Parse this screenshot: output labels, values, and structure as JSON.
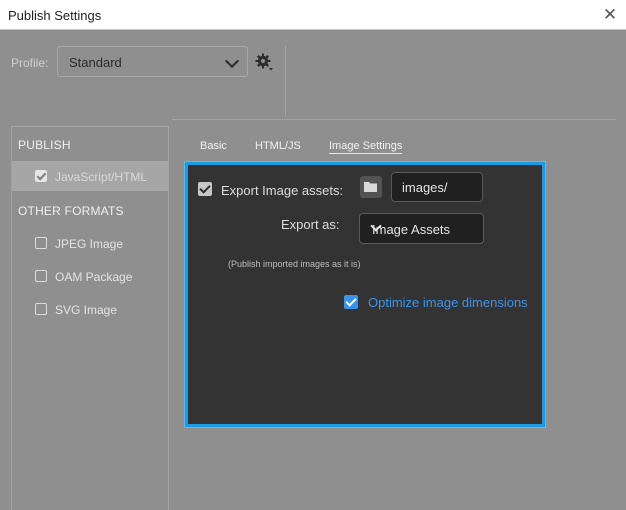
{
  "window": {
    "title": "Publish Settings",
    "close_glyph": "✕"
  },
  "profile": {
    "label": "Profile:",
    "value": "Standard"
  },
  "sidebar": {
    "publish_heading": "PUBLISH",
    "publish_items": [
      {
        "label": "JavaScript/HTML",
        "checked": true,
        "selected": true
      }
    ],
    "other_heading": "OTHER FORMATS",
    "other_items": [
      {
        "label": "JPEG Image",
        "checked": false
      },
      {
        "label": "OAM Package",
        "checked": false
      },
      {
        "label": "SVG Image",
        "checked": false
      }
    ]
  },
  "tabs": [
    {
      "label": "Basic"
    },
    {
      "label": "HTML/JS"
    },
    {
      "label": "Image Settings",
      "active": true
    }
  ],
  "image_settings": {
    "export_assets_label": "Export Image assets:",
    "export_assets_checked": true,
    "folder_value": "images/",
    "export_as_label": "Export as:",
    "export_as_value": "Image Assets",
    "note": "(Publish imported images as it is)",
    "optimize_label": "Optimize image dimensions",
    "optimize_checked": true
  },
  "colors": {
    "accent": "#1e9be0",
    "checkbox_blue": "#3a92e6",
    "link_blue": "#3b94ea",
    "panel_bg": "#333333",
    "dialog_bg": "#8f8f8f"
  },
  "icons": {
    "close": "close-icon",
    "gear": "gear-icon",
    "folder": "folder-icon",
    "chevron": "chevron-down-icon"
  }
}
